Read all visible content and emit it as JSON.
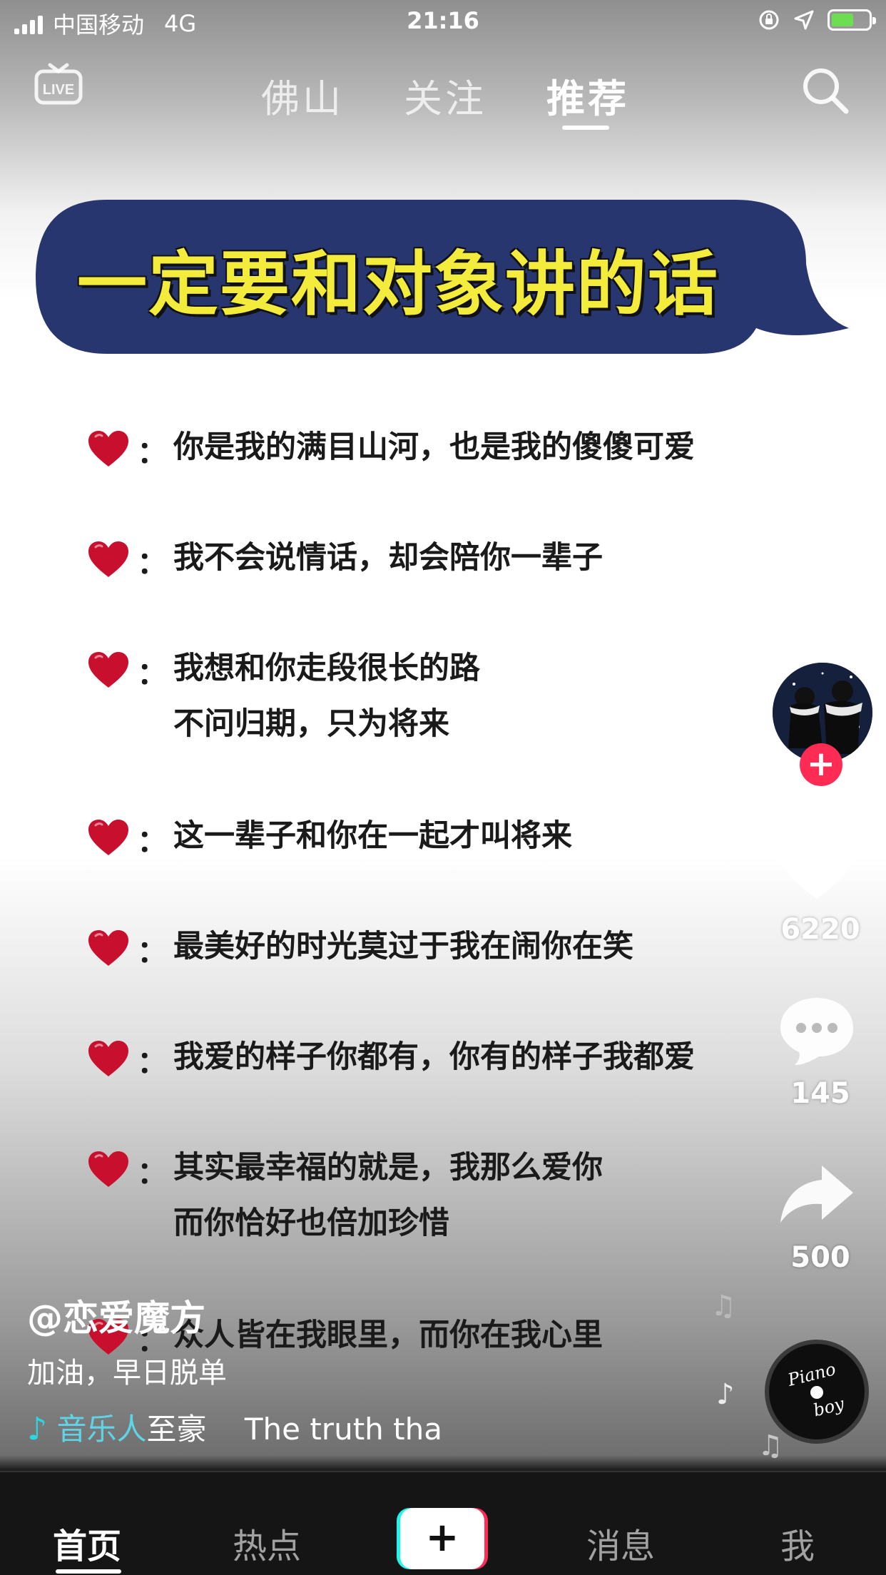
{
  "status_bar": {
    "carrier": "中国移动",
    "network": "4G",
    "time": "21:16",
    "battery_level": 0.5
  },
  "top_nav": {
    "live_label": "LIVE",
    "tabs": [
      {
        "label": "佛山"
      },
      {
        "label": "关注"
      },
      {
        "label": "推荐",
        "active": true
      }
    ]
  },
  "video": {
    "banner_title": "一定要和对象讲的话",
    "lines": [
      {
        "text": "你是我的满目山河，也是我的傻傻可爱"
      },
      {
        "text": "我不会说情话，却会陪你一辈子"
      },
      {
        "text": "我想和你走段很长的路\n不问归期，只为将来"
      },
      {
        "text": "这一辈子和你在一起才叫将来"
      },
      {
        "text": "最美好的时光莫过于我在闹你在笑"
      },
      {
        "text": "我爱的样子你都有，你有的样子我都爱"
      },
      {
        "text": "其实最幸福的就是，我那么爱你\n而你恰好也倍加珍惜"
      },
      {
        "text": "众人皆在我眼里，而你在我心里"
      }
    ],
    "colon": "："
  },
  "actions": {
    "likes": "6220",
    "comments": "145",
    "shares": "500",
    "follow_symbol": "+",
    "disc_text_1": "Piano",
    "disc_text_2": "boy"
  },
  "caption": {
    "author": "@恋爱魔方",
    "description": "加油，早日脱单",
    "music_note": "♪",
    "music_artist": "音乐人",
    "music_title": "至豪    The truth tha"
  },
  "bottom_nav": {
    "items": [
      {
        "label": "首页",
        "active": true
      },
      {
        "label": "热点"
      },
      {
        "label": "+"
      },
      {
        "label": "消息"
      },
      {
        "label": "我"
      }
    ]
  },
  "colors": {
    "accent_red": "#fe2c55",
    "accent_cyan": "#25f4ee",
    "banner_blue": "#27366f",
    "banner_text": "#f3ec3c",
    "heart_red": "#c8102e"
  }
}
